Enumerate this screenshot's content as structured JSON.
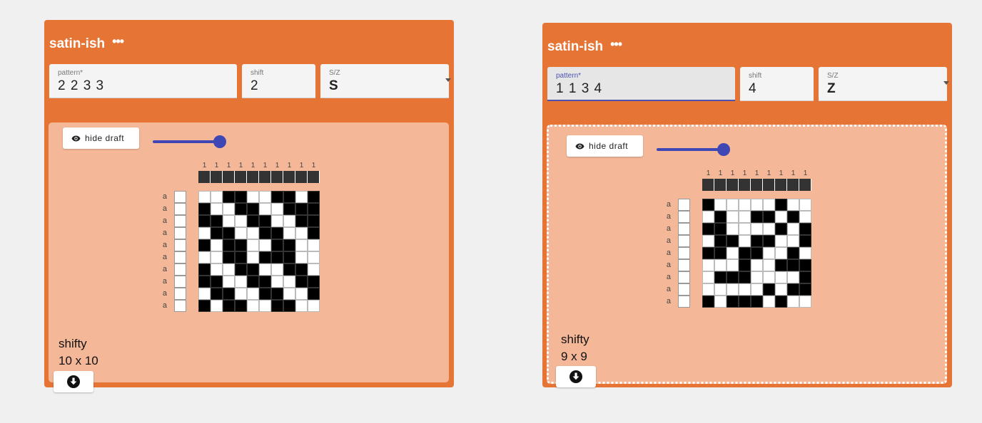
{
  "cards": [
    {
      "title": "satin-ish",
      "more_label": "•••",
      "pattern": {
        "label": "pattern*",
        "value": "2 2 3 3"
      },
      "shift": {
        "label": "shift",
        "value": "2"
      },
      "sz": {
        "label": "S/Z",
        "value": "S"
      },
      "hide_label": "hide draft",
      "slider_value": 0.85,
      "warp_ticks": [
        "1",
        "1",
        "1",
        "1",
        "1",
        "1",
        "1",
        "1",
        "1",
        "1"
      ],
      "row_labels": [
        "a",
        "a",
        "a",
        "a",
        "a",
        "a",
        "a",
        "a",
        "a",
        "a"
      ],
      "draft_rows": [
        "0011001101",
        "1001100111",
        "1100110011",
        "0110011001",
        "1011001100",
        "0011011100",
        "1001100110",
        "1100110011",
        "0110011001",
        "1011001100"
      ],
      "info_name": "shifty",
      "info_size": "10 x 10"
    },
    {
      "title": "satin-ish",
      "more_label": "•••",
      "pattern": {
        "label": "pattern*",
        "value": "1 1 3 4"
      },
      "shift": {
        "label": "shift",
        "value": "4"
      },
      "sz": {
        "label": "S/Z",
        "value": "Z"
      },
      "hide_label": "hide draft",
      "slider_value": 0.85,
      "warp_ticks": [
        "1",
        "1",
        "1",
        "1",
        "1",
        "1",
        "1",
        "1",
        "1"
      ],
      "row_labels": [
        "a",
        "a",
        "a",
        "a",
        "a",
        "a",
        "a",
        "a",
        "a"
      ],
      "draft_rows": [
        "100000100",
        "010011010",
        "110000101",
        "011011001",
        "110110010",
        "000100111",
        "011100001",
        "000001011",
        "101110100"
      ],
      "info_name": "shifty",
      "info_size": "9 x 9"
    }
  ],
  "colors": {
    "card": "#e67535",
    "panel": "#f4b898",
    "accent": "#3f47b5"
  }
}
